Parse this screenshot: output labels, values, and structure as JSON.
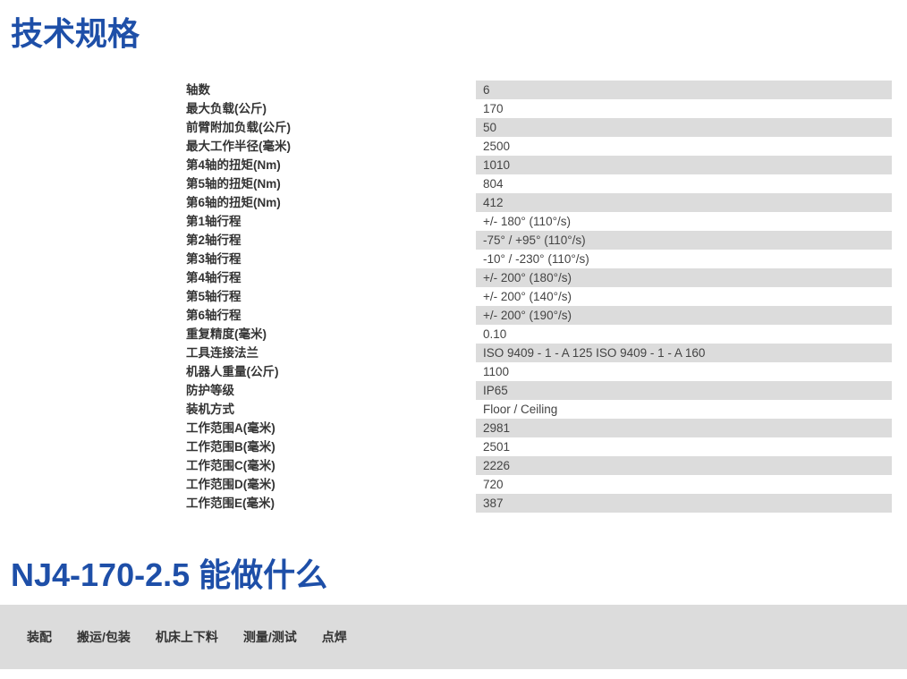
{
  "spec_section": {
    "title": "技术规格",
    "rows": [
      {
        "key": "轴数",
        "value": "6"
      },
      {
        "key": "最大负载(公斤)",
        "value": "170"
      },
      {
        "key": "前臂附加负载(公斤)",
        "value": "50"
      },
      {
        "key": "最大工作半径(毫米)",
        "value": "2500"
      },
      {
        "key": "第4轴的扭矩(Nm)",
        "value": "1010"
      },
      {
        "key": "第5轴的扭矩(Nm)",
        "value": "804"
      },
      {
        "key": "第6轴的扭矩(Nm)",
        "value": "412"
      },
      {
        "key": "第1轴行程",
        "value": "+/- 180° (110°/s)"
      },
      {
        "key": "第2轴行程",
        "value": "-75° / +95° (110°/s)"
      },
      {
        "key": "第3轴行程",
        "value": "-10° / -230° (110°/s)"
      },
      {
        "key": "第4轴行程",
        "value": "+/- 200° (180°/s)"
      },
      {
        "key": "第5轴行程",
        "value": "+/- 200° (140°/s)"
      },
      {
        "key": "第6轴行程",
        "value": "+/- 200° (190°/s)"
      },
      {
        "key": "重复精度(毫米)",
        "value": "0.10"
      },
      {
        "key": "工具连接法兰",
        "value": "ISO 9409 - 1 - A 125 ISO 9409 - 1 - A 160"
      },
      {
        "key": "机器人重量(公斤)",
        "value": "1100"
      },
      {
        "key": "防护等级",
        "value": "IP65"
      },
      {
        "key": "装机方式",
        "value": "Floor / Ceiling"
      },
      {
        "key": "工作范围A(毫米)",
        "value": "2981"
      },
      {
        "key": "工作范围B(毫米)",
        "value": "2501"
      },
      {
        "key": "工作范围C(毫米)",
        "value": "2226"
      },
      {
        "key": "工作范围D(毫米)",
        "value": "720"
      },
      {
        "key": "工作范围E(毫米)",
        "value": "387"
      }
    ]
  },
  "use_section": {
    "title": "NJ4-170-2.5 能做什么",
    "tabs": [
      {
        "label": "装配"
      },
      {
        "label": "搬运/包装"
      },
      {
        "label": "机床上下料"
      },
      {
        "label": "测量/测试"
      },
      {
        "label": "点焊"
      }
    ]
  },
  "colors": {
    "title_blue": "#1e4fa8",
    "row_stripe": "#dcdcdc",
    "bar_background": "#dcdcdc"
  }
}
